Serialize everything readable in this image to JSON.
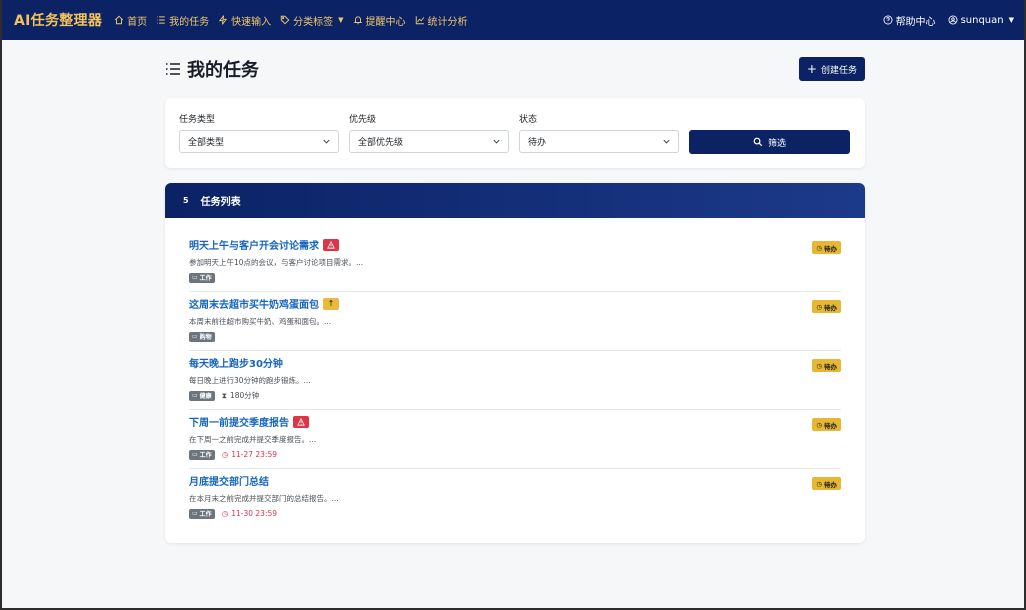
{
  "navbar": {
    "brand": "AI任务整理器",
    "links": [
      {
        "label": "首页",
        "icon": "home-icon"
      },
      {
        "label": "我的任务",
        "icon": "list-icon"
      },
      {
        "label": "快速输入",
        "icon": "bolt-icon"
      },
      {
        "label": "分类标签",
        "icon": "tag-icon"
      },
      {
        "label": "提醒中心",
        "icon": "bell-icon"
      },
      {
        "label": "统计分析",
        "icon": "chart-icon"
      }
    ],
    "help": "帮助中心",
    "user": "sunquan"
  },
  "page": {
    "title": "我的任务",
    "create_button": "创建任务"
  },
  "filters": {
    "type": {
      "label": "任务类型",
      "value": "全部类型"
    },
    "priority": {
      "label": "优先级",
      "value": "全部优先级"
    },
    "status": {
      "label": "状态",
      "value": "待办"
    },
    "submit": "筛选"
  },
  "list": {
    "count": "5",
    "title": "任务列表",
    "tasks": [
      {
        "title": "明天上午与客户开会讨论需求",
        "priority": "high",
        "description": "参加明天上午10点的会议，与客户讨论项目需求。...",
        "tag": "工作",
        "status": "待办"
      },
      {
        "title": "这周末去超市买牛奶鸡蛋面包",
        "priority": "medium",
        "description": "本周末前往超市购买牛奶、鸡蛋和面包。...",
        "tag": "购物",
        "status": "待办"
      },
      {
        "title": "每天晚上跑步30分钟",
        "description": "每日晚上进行30分钟的跑步锻炼。...",
        "tag": "健康",
        "duration": "180分钟",
        "status": "待办"
      },
      {
        "title": "下周一前提交季度报告",
        "priority": "high",
        "description": "在下周一之前完成并提交季度报告。...",
        "tag": "工作",
        "due": "11-27 23:59",
        "status": "待办"
      },
      {
        "title": "月底提交部门总结",
        "description": "在本月末之前完成并提交部门的总结报告。...",
        "tag": "工作",
        "due": "11-30 23:59",
        "status": "待办"
      }
    ]
  },
  "colors": {
    "navbar": "#0b2265",
    "brand": "#f3c25a",
    "link": "#1565c0",
    "danger": "#dc3545",
    "warning": "#e5b733",
    "tag": "#6c757d"
  }
}
